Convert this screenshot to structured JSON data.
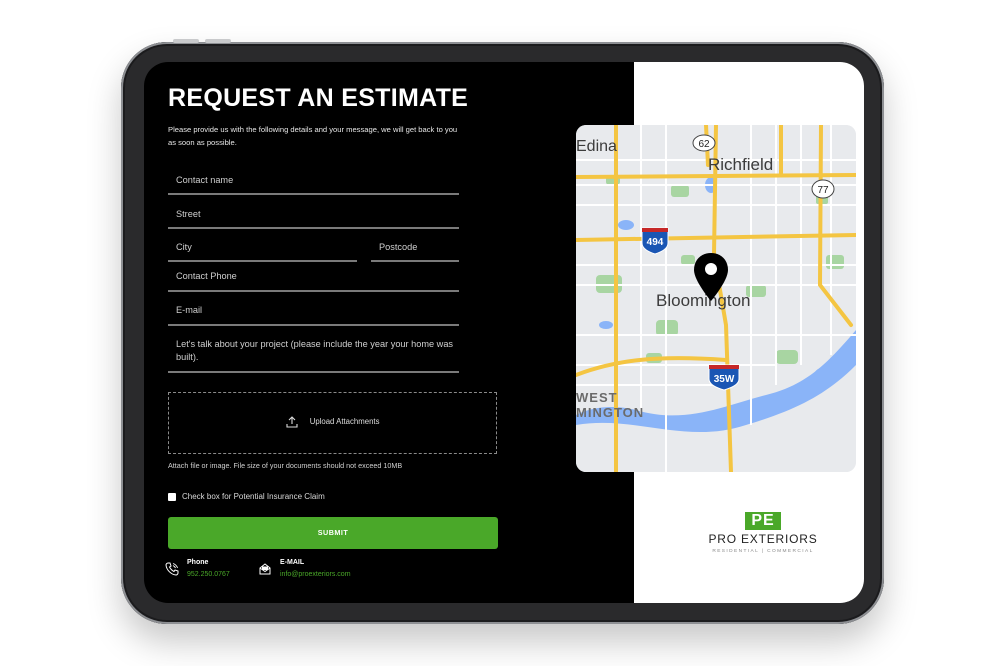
{
  "form": {
    "title": "REQUEST AN ESTIMATE",
    "subtitle": "Please provide us with the following details and your message, we will get back to you as soon as possible.",
    "fields": {
      "contact_name": "Contact name",
      "street": "Street",
      "city": "City",
      "postcode": "Postcode",
      "contact_phone": "Contact Phone",
      "email": "E-mail",
      "project": "Let's talk about your project (please include the year your home was built)."
    },
    "upload_label": "Upload Attachments",
    "upload_note": "Attach file or image. File size of your documents should not exceed 10MB",
    "insurance_checkbox_label": "Check box for Potential Insurance Claim",
    "submit_label": "SUBMIT"
  },
  "contact": {
    "phone_label": "Phone",
    "phone_value": "952.250.0767",
    "email_label": "E-MAIL",
    "email_value": "info@proexteriors.com"
  },
  "map": {
    "labels": {
      "edina": "Edina",
      "richfield": "Richfield",
      "bloomington": "Bloomington",
      "west_bloomington_1": "WEST",
      "west_bloomington_2": "MINGTON"
    },
    "shields": {
      "us62": "62",
      "us77": "77",
      "i494": "494",
      "i35w": "35W"
    }
  },
  "logo": {
    "mark": "PE",
    "name": "PRO EXTERIORS",
    "tagline": "RESIDENTIAL | COMMERCIAL"
  },
  "colors": {
    "accent": "#4aa829",
    "background": "#000000"
  }
}
